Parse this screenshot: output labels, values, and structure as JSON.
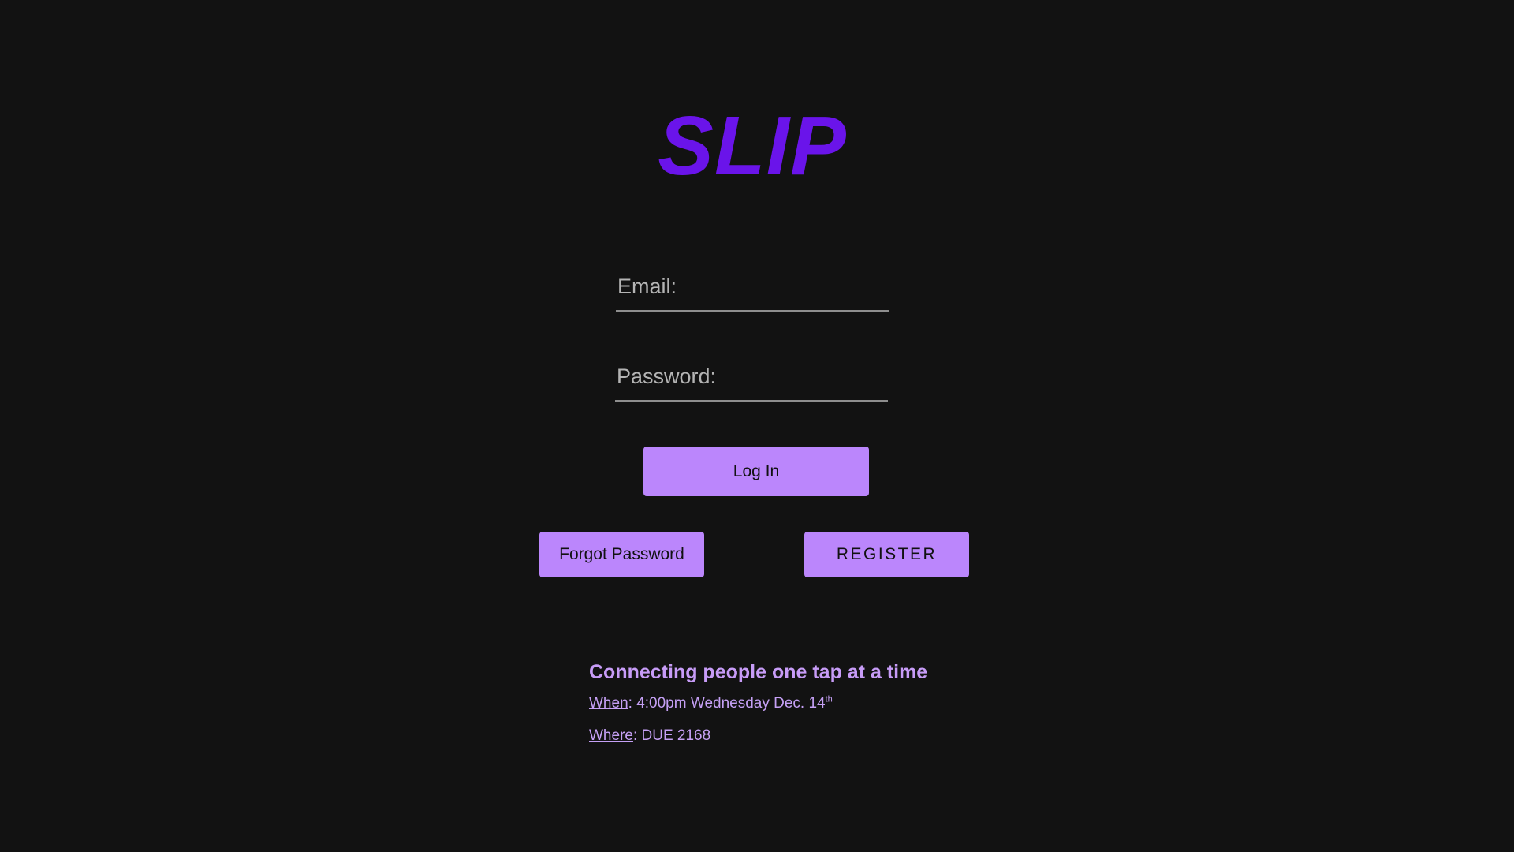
{
  "app": {
    "logo_text": "SLIP"
  },
  "form": {
    "email_placeholder": "Email:",
    "password_placeholder": "Password:",
    "login_label": "Log In",
    "forgot_label": "Forgot Password",
    "register_label": "REGISTER"
  },
  "info": {
    "tagline": "Connecting people one tap at a time",
    "when_label": "When",
    "when_value": ": 4:00pm Wednesday Dec. 14",
    "when_suffix": "th",
    "where_label": "Where",
    "where_value": ": DUE 2168"
  },
  "colors": {
    "background": "#121212",
    "logo": "#6a14ea",
    "button": "#bb86fc",
    "info_text": "#c5a0f5"
  }
}
